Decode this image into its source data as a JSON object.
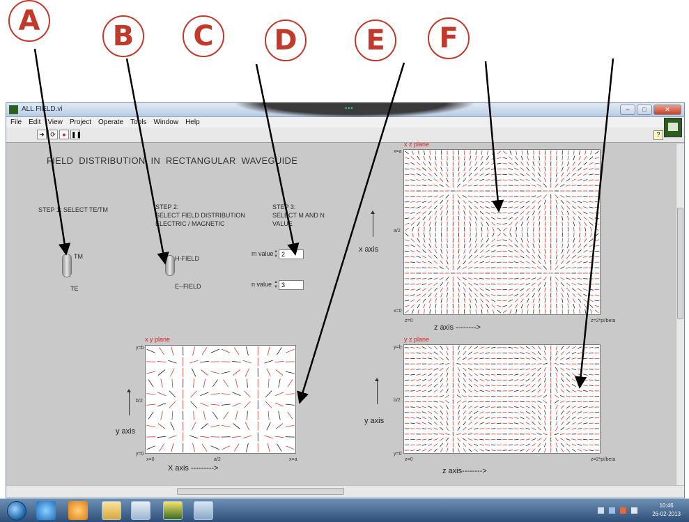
{
  "callouts": [
    "A",
    "B",
    "C",
    "D",
    "E",
    "F"
  ],
  "window": {
    "title": "ALL FIELD.vi",
    "menu": [
      "File",
      "Edit",
      "View",
      "Project",
      "Operate",
      "Tools",
      "Window",
      "Help"
    ],
    "toolbar": [
      "run-arrow",
      "run-continuously",
      "abort-stop",
      "pause"
    ]
  },
  "panel": {
    "title": "FIELD DISTRIBUTION IN RECTANGULAR WAVEGUIDE",
    "step1": "STEP 1: SELECT TE/TM",
    "step2_line1": "STEP 2:",
    "step2_line2": "SELECT FIELD DISTRIBUTION",
    "step2_line3": "ELECTRIC / MAGNETIC",
    "step3_line1": "STEP 3:",
    "step3_line2": "SELECT M AND N",
    "step3_line3": "VALUE",
    "mode_toggle": {
      "top": "TM",
      "bottom": "TE"
    },
    "field_toggle": {
      "top": "H-FIELD",
      "bottom": "E--FIELD"
    },
    "m": {
      "label": "m value",
      "value": "2"
    },
    "n": {
      "label": "n value",
      "value": "3"
    }
  },
  "plots": {
    "xz": {
      "title": "x z plane",
      "ticks_y": [
        "x=a",
        "a/2",
        "x=0"
      ],
      "ticks_x": [
        "z=0",
        "z=2*pi/beta"
      ],
      "xlabel": "z axis -------->",
      "ylabel": "x axis"
    },
    "yz": {
      "title": "y z plane",
      "ticks_y": [
        "y=b",
        "b/2",
        "y=0"
      ],
      "ticks_x": [
        "z=0",
        "z=2*pi/beta"
      ],
      "xlabel": "z axis-------->",
      "ylabel": "y axis"
    },
    "xy": {
      "title": "x y plane",
      "ticks_y": [
        "y=b",
        "b/2",
        "y=0"
      ],
      "ticks_x": [
        "x=0",
        "a/2",
        "x=a"
      ],
      "xlabel": "X axis --------->",
      "ylabel": "y axis"
    }
  },
  "taskbar": {
    "time": "10:46",
    "date": "26-02-2013"
  },
  "colors": {
    "field_red": "#d23a2a",
    "field_black": "#222222",
    "callout_red": "#c0392b"
  }
}
